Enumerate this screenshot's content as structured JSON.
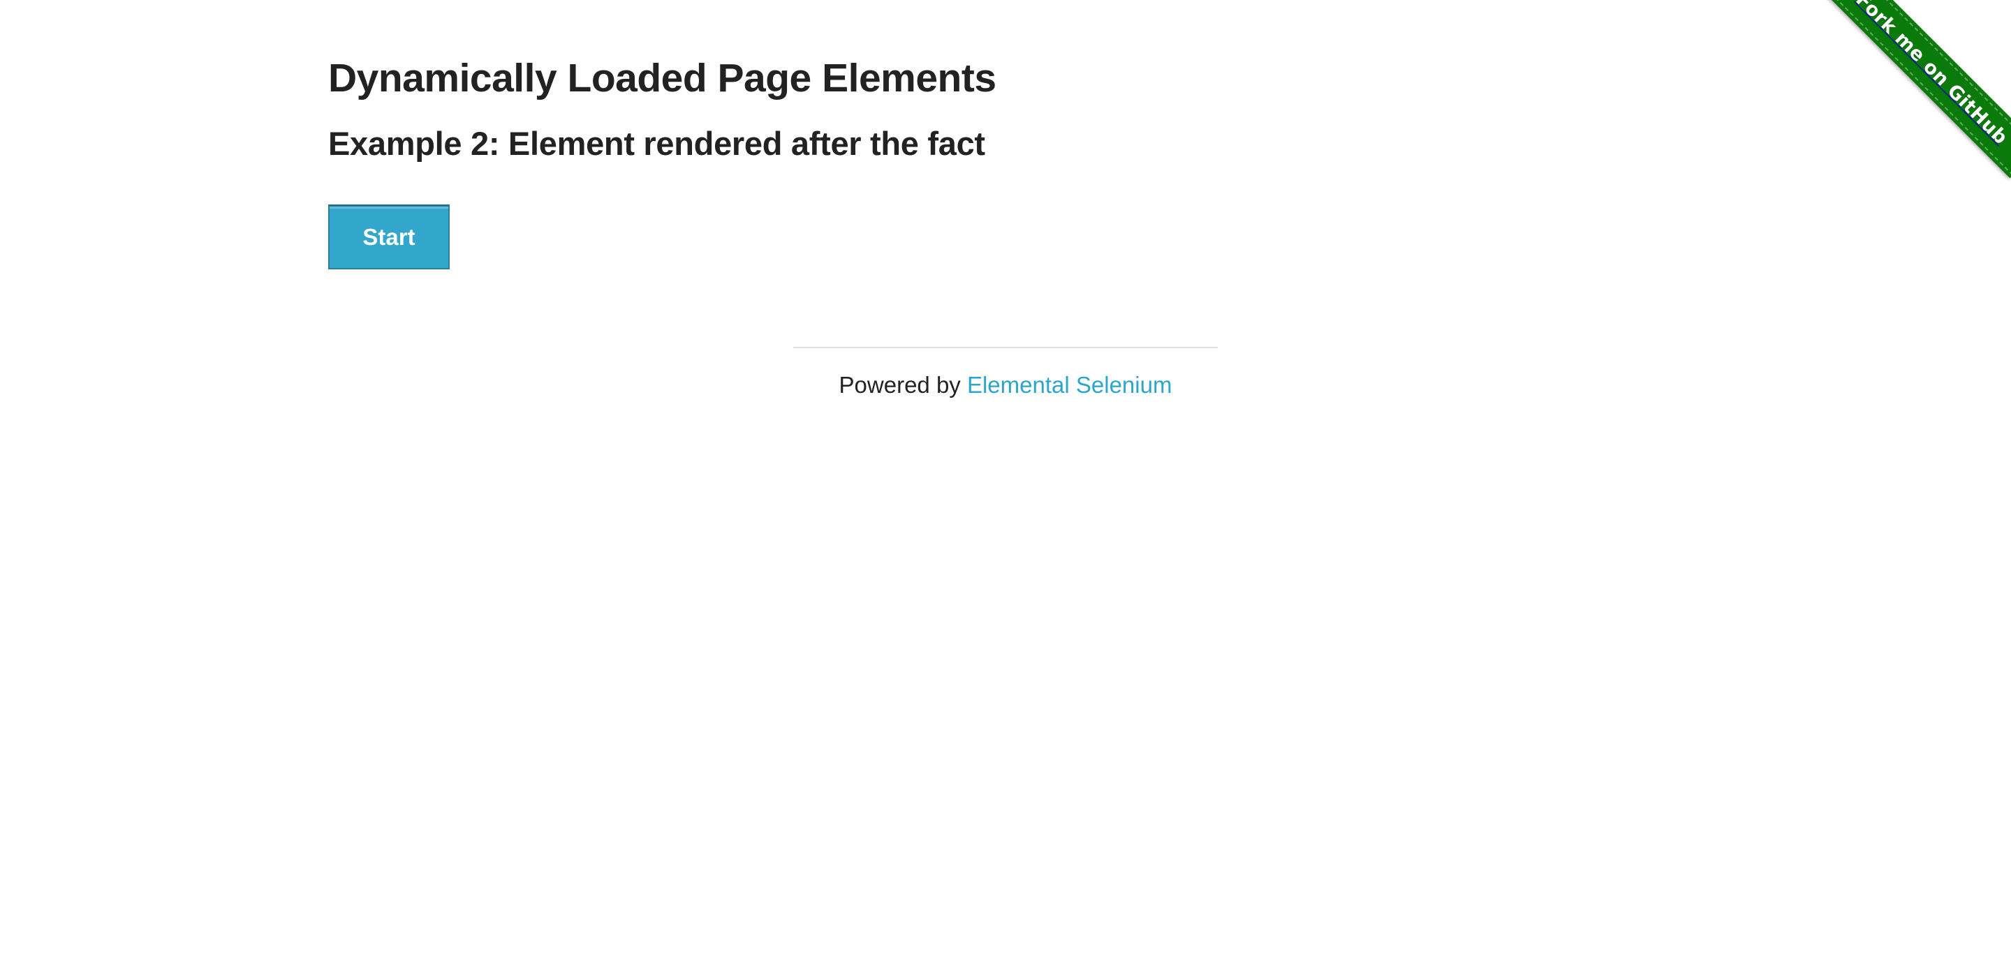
{
  "main": {
    "title": "Dynamically Loaded Page Elements",
    "subtitle": "Example 2: Element rendered after the fact",
    "start_button_label": "Start"
  },
  "footer": {
    "prefix": "Powered by ",
    "link_text": "Elemental Selenium"
  },
  "ribbon": {
    "label": "Fork me on GitHub"
  },
  "colors": {
    "button_bg": "#33a7cb",
    "link": "#2ba6cb",
    "ribbon": "#0a7a0a"
  }
}
